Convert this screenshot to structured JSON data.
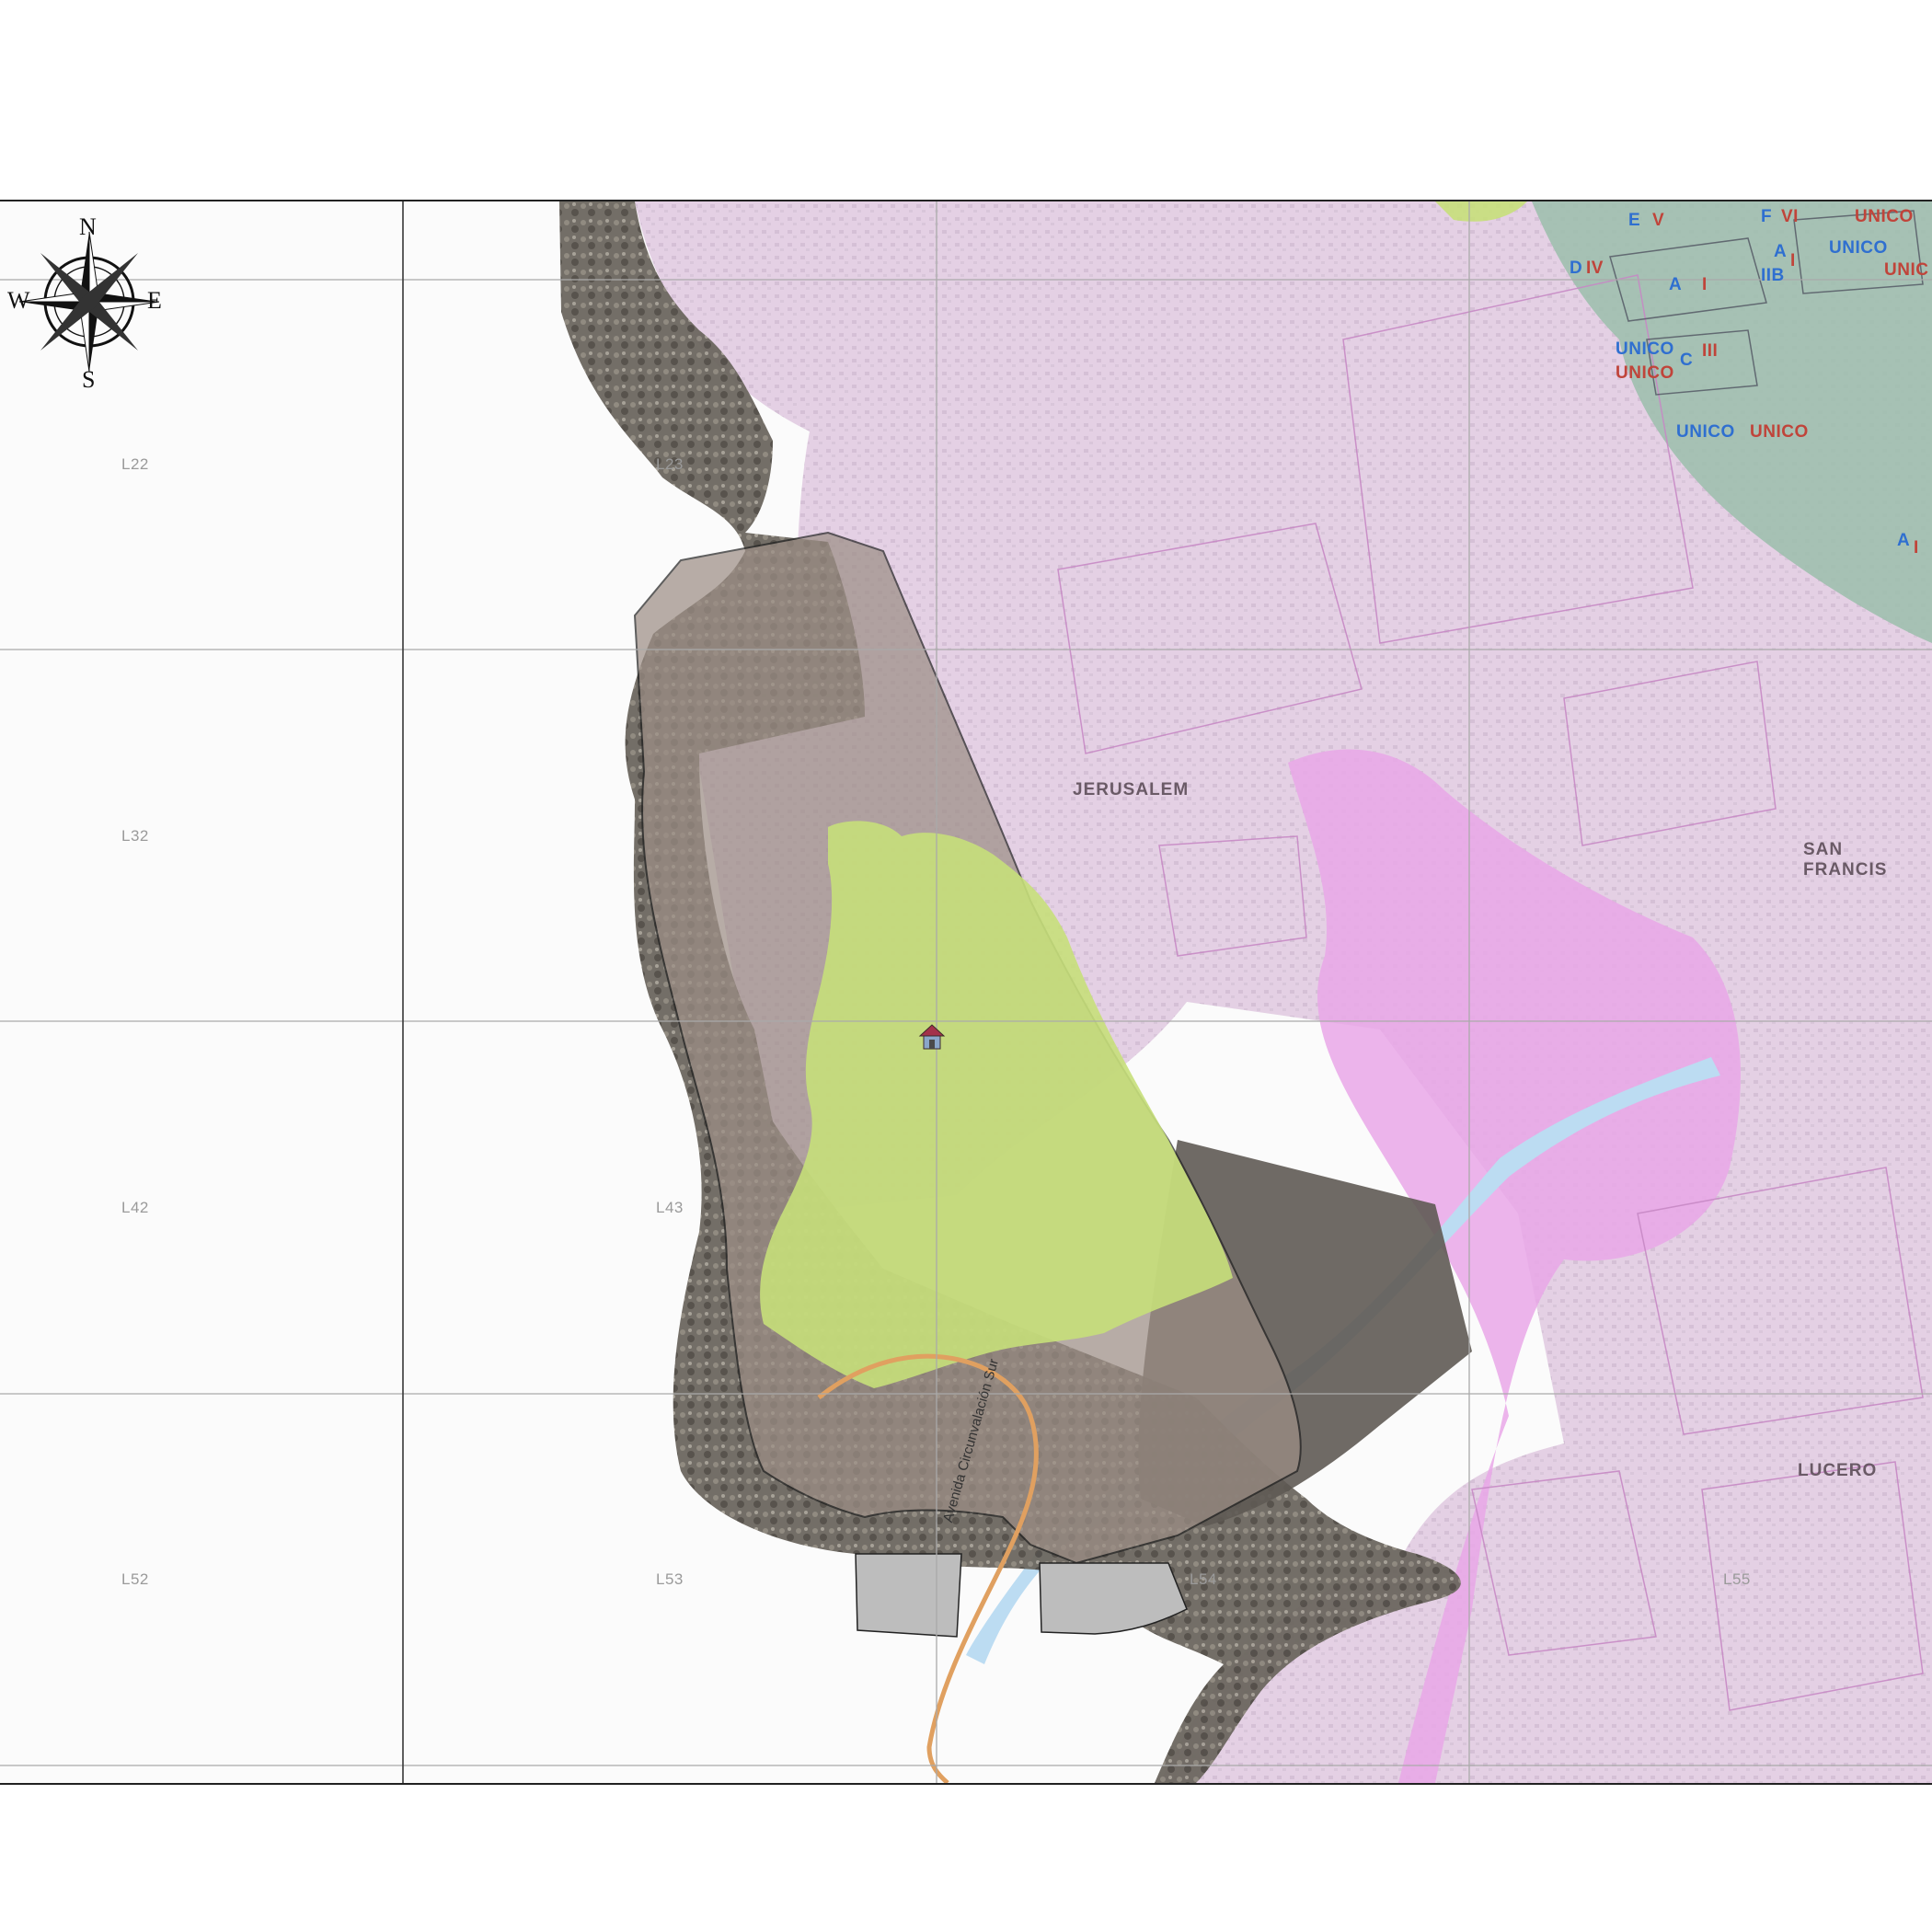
{
  "compass": {
    "north": "N",
    "south": "S",
    "east": "E",
    "west": "W"
  },
  "grid_labels": [
    "L22",
    "L23",
    "L32",
    "L42",
    "L43",
    "L52",
    "L53",
    "L54",
    "L55"
  ],
  "places": {
    "jerusalem": "JERUSALEM",
    "san_francisco": "SAN FRANCIS",
    "lucero": "LUCERO"
  },
  "road": {
    "name": "Avenida Circunvalación Sur"
  },
  "zone_labels": [
    {
      "text": "E",
      "kind": "blue"
    },
    {
      "text": "V",
      "kind": "red"
    },
    {
      "text": "F",
      "kind": "blue"
    },
    {
      "text": "VI",
      "kind": "red"
    },
    {
      "text": "UNICO",
      "kind": "red"
    },
    {
      "text": "UNICO",
      "kind": "blue"
    },
    {
      "text": "UNIC",
      "kind": "red"
    },
    {
      "text": "D",
      "kind": "blue"
    },
    {
      "text": "IV",
      "kind": "red"
    },
    {
      "text": "A",
      "kind": "blue"
    },
    {
      "text": "I",
      "kind": "red"
    },
    {
      "text": "A",
      "kind": "blue"
    },
    {
      "text": "I",
      "kind": "red"
    },
    {
      "text": "IIB",
      "kind": "blue"
    },
    {
      "text": "UNICO",
      "kind": "blue"
    },
    {
      "text": "C",
      "kind": "blue"
    },
    {
      "text": "III",
      "kind": "red"
    },
    {
      "text": "UNICO",
      "kind": "red"
    },
    {
      "text": "UNICO",
      "kind": "blue"
    },
    {
      "text": "UNICO",
      "kind": "red"
    },
    {
      "text": "A",
      "kind": "blue"
    },
    {
      "text": "I",
      "kind": "red"
    }
  ],
  "colors": {
    "urban_zone": "#e6cfe6",
    "green_zone": "#c6df7a",
    "protected_zone": "#9d8f86",
    "rock_terrain": "#6f6a63",
    "teal_zone": "#9fbfae",
    "river": "#bcdcf2",
    "road": "#e0a060",
    "pink_zone": "#e9a7e8"
  },
  "icons": {
    "poi": "hut-icon",
    "compass": "compass-rose-icon"
  }
}
